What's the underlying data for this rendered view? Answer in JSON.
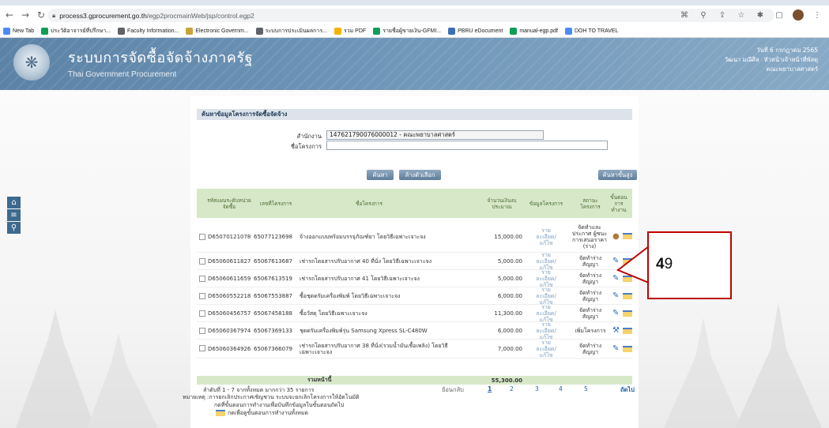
{
  "browser": {
    "url_host": "process3.gprocurement.go.th",
    "url_path": "/egp2procmainWeb/jsp/control.egp2",
    "bookmarks": [
      {
        "label": "New Tab",
        "color": "#4c8bf5"
      },
      {
        "label": "ประวัติอาจารย์ที่ปรึกษา...",
        "color": "#0f9d58"
      },
      {
        "label": "Faculty Information...",
        "color": "#5f6368"
      },
      {
        "label": "Electronic Governm...",
        "color": "#c7a33a"
      },
      {
        "label": "ระบบการประเมินผลการ...",
        "color": "#5f6368"
      },
      {
        "label": "รวม PDF",
        "color": "#f4b400"
      },
      {
        "label": "รายชื่อผู้ขายเงิน-GFMI...",
        "color": "#0f9d58"
      },
      {
        "label": "PBRU eDocument",
        "color": "#3b6fb6"
      },
      {
        "label": "manual-egp.pdf",
        "color": "#0f9d58"
      },
      {
        "label": "DOH TO TRAVEL",
        "color": "#4c8bf5"
      }
    ]
  },
  "header": {
    "title": "ระบบการจัดซื้อจัดจ้างภาครัฐ",
    "subtitle": "Thai Government Procurement",
    "date": "วันที่ 6 กรกฎาคม 2565",
    "user": "วัฒนา มณีศิล",
    "role": "หัวหน้าเจ้าหน้าที่พัสดุ",
    "org": "คณะพยาบาลศาสตร์"
  },
  "panel": {
    "title": "ค้นหาข้อมูลโครงการจัดซื้อจัดจ้าง",
    "agency_label": "สำนักงาน",
    "agency_value": "147621790076000012 - คณะพยาบาลศาสตร์",
    "project_label": "ชื่อโครงการ",
    "project_value": "",
    "search_button": "ค้นหา",
    "clear_button": "ล้างตัวเลือก",
    "advanced_button": "ค้นหาขั้นสูง"
  },
  "table": {
    "headers": [
      "รหัสแผนระดับหน่วยจัดซื้อ",
      "เลขที่โครงการ",
      "ชื่อโครงการ",
      "จำนวนเงินงบประมาณ",
      "ข้อมูลโครงการ",
      "สถานะโครงการ",
      "ขั้นตอนการทำงาน"
    ],
    "rows": [
      {
        "plan": "D65070121078",
        "proj": "65077123698",
        "name": "จ้างออกแบบพร้อมบรรจุภัณฑ์ยา โดยวิธีเฉพาะเจาะจง",
        "amount": "15,000.00",
        "info": "รายละเอียด/แก้ไข",
        "status": "จัดทำและประกาศ ผู้ชนะการเสนอราคา (ร่าง)"
      },
      {
        "plan": "D65060611827",
        "proj": "65067613687",
        "name": "เช่ารถโดยสารปรับอากาศ 40 ที่นั่ง โดยวิธีเฉพาะเจาะจง",
        "amount": "5,000.00",
        "info": "รายละเอียด/แก้ไข",
        "status": "จัดทำร่างสัญญา"
      },
      {
        "plan": "D65060611659",
        "proj": "65067613519",
        "name": "เช่ารถโดยสารปรับอากาศ 41 โดยวิธีเฉพาะเจาะจง",
        "amount": "5,000.00",
        "info": "รายละเอียด/แก้ไข",
        "status": "จัดทำร่างสัญญา"
      },
      {
        "plan": "D65060552218",
        "proj": "65067553887",
        "name": "ซื้อชุดดรัมเครื่องพิมพ์ โดยวิธีเฉพาะเจาะจง",
        "amount": "6,000.00",
        "info": "รายละเอียด/แก้ไข",
        "status": "จัดทำร่างสัญญา"
      },
      {
        "plan": "D65060456757",
        "proj": "65067458188",
        "name": "ซื้อวัสดุ โดยวิธีเฉพาะเจาะจง",
        "amount": "11,300.00",
        "info": "รายละเอียด/แก้ไข",
        "status": "จัดทำร่างสัญญา"
      },
      {
        "plan": "D65060367974",
        "proj": "65067369133",
        "name": "ชุดดรัมเครื่องพิมพ์รุ่น Samsung Xpress SL-C480W",
        "amount": "6,000.00",
        "info": "รายละเอียด/แก้ไข",
        "status": "เพิ่มโครงการ"
      },
      {
        "plan": "D65060364926",
        "proj": "65067366079",
        "name": "เช่ารถโดยสารปรับอากาศ 38 ที่นั่ง(รวมน้ำมันเชื้อเพลิง) โดยวิธีเฉพาะเจาะจง",
        "amount": "7,000.00",
        "info": "รายละเอียด/แก้ไข",
        "status": "จัดทำร่างสัญญา"
      }
    ],
    "total_label": "รวมหน้านี้",
    "total_value": "55,300.00"
  },
  "footer": {
    "range": "ลำดับที่ 1 - 7 จากทั้งหมด มากกว่า 35 รายการ",
    "note1": "หมายเหตุ :การยกเลิกประกาศเชิญชวน ระบบจะยกเลิกโครงการให้อัตโนมัติ",
    "note2": "กดที่ขั้นตอนการทำงานเพื่อบันทึกข้อมูลในขั้นตอนถัดไป",
    "note3": "กดเพื่อดูขั้นตอนการทำงานทั้งหมด",
    "prev": "ย้อนกลับ",
    "pages": [
      "1",
      "2",
      "3",
      "4",
      "5"
    ],
    "next": "ถัดไป"
  },
  "callout": {
    "number_bold": "4",
    "number_rest": "9"
  }
}
